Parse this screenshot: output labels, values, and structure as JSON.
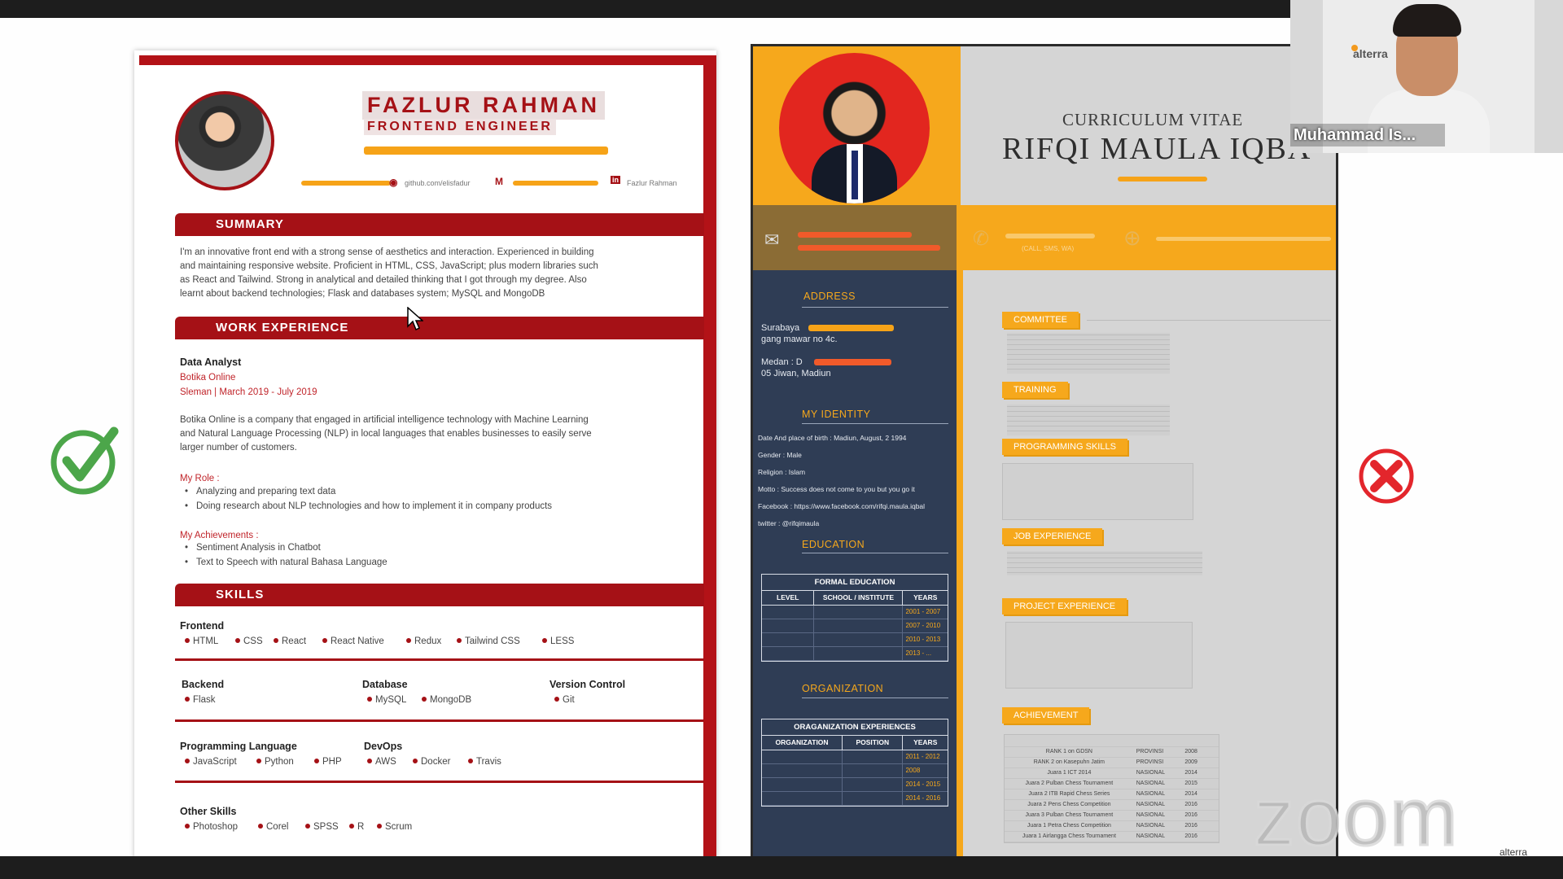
{
  "left_cv": {
    "name": "FAZLUR RAHMAN",
    "role": "FRONTEND ENGINEER",
    "contacts": {
      "github": "github.com/elisfadur",
      "linkedin": "Fazlur Rahman"
    },
    "sections": {
      "summary": "SUMMARY",
      "work": "WORK EXPERIENCE",
      "skills": "SKILLS"
    },
    "summary_lines": [
      "I'm an innovative front end with a strong sense of aesthetics and interaction. Experienced in building",
      "and maintaining responsive website. Proficient in HTML, CSS, JavaScript; plus modern libraries such",
      "as React and Tailwind. Strong in analytical and detailed thinking that I got through my degree. Also",
      "learnt about backend technologies; Flask and databases system; MySQL and MongoDB"
    ],
    "job": {
      "title": "Data Analyst",
      "company": "Botika Online",
      "period": "Sleman | March 2019 - July 2019",
      "desc": [
        "Botika Online is a company that engaged in artificial intelligence technology with Machine Learning",
        "and Natural Language Processing (NLP) in local languages that enables businesses to easily serve",
        "larger number of customers."
      ],
      "role_label": "My Role :",
      "roles": [
        "Analyzing and preparing text data",
        "Doing research about NLP technologies and how to implement it in company products"
      ],
      "ach_label": "My Achievements :",
      "achievements": [
        "Sentiment Analysis in Chatbot",
        "Text to Speech with natural Bahasa Language"
      ]
    },
    "skills": {
      "frontend": {
        "label": "Frontend",
        "items": [
          "HTML",
          "CSS",
          "React",
          "React Native",
          "Redux",
          "Tailwind CSS",
          "LESS"
        ]
      },
      "backend": {
        "label": "Backend",
        "items": [
          "Flask"
        ]
      },
      "database": {
        "label": "Database",
        "items": [
          "MySQL",
          "MongoDB"
        ]
      },
      "vcs": {
        "label": "Version Control",
        "items": [
          "Git"
        ]
      },
      "prog": {
        "label": "Programming Language",
        "items": [
          "JavaScript",
          "Python",
          "PHP"
        ]
      },
      "devops": {
        "label": "DevOps",
        "items": [
          "AWS",
          "Docker",
          "Travis"
        ]
      },
      "other": {
        "label": "Other Skills",
        "items": [
          "Photoshop",
          "Corel",
          "SPSS",
          "R",
          "Scrum"
        ]
      }
    }
  },
  "right_cv": {
    "title": "CURRICULUM VITAE",
    "name": "RIFQI MAULA IQBA",
    "headings": {
      "address": "ADDRESS",
      "identity": "MY IDENTITY",
      "education": "EDUCATION",
      "organization": "ORGANIZATION",
      "committee": "COMMITTEE",
      "training": "TRAINING",
      "programming": "PROGRAMMING SKILLS",
      "job": "JOB EXPERIENCE",
      "project": "PROJECT EXPERIENCE",
      "achievement": "ACHIEVEMENT"
    },
    "address_1a": "Surabaya",
    "address_1b": "gang mawar no 4c.",
    "address_2a": "Medan : D",
    "address_2b": "05 Jiwan, Madiun",
    "identity": [
      "Date And place of birth : Madiun, August, 2   1994",
      "Gender : Male",
      "Religion : Islam",
      "Motto : Success does not come to you but you go it",
      "Facebook : https://www.facebook.com/rifqi.maula.iqbal",
      "twitter : @rifqimaula"
    ],
    "edu_table_title": "FORMAL EDUCATION",
    "edu_cols": [
      "LEVEL",
      "SCHOOL / INSTITUTE",
      "YEARS"
    ],
    "edu_years": [
      "2001 - 2007",
      "2007 - 2010",
      "2010 - 2013",
      "2013 - ..."
    ],
    "org_table_title": "ORAGANIZATION EXPERIENCES",
    "org_cols": [
      "ORGANIZATION",
      "POSITION",
      "YEARS"
    ],
    "org_years": [
      "2011 - 2012",
      "2008",
      "2014 - 2015",
      "2014 - 2016"
    ],
    "phone_hint": "(CALL, SMS, WA)",
    "achievements": [
      [
        "RANK 1 on GDSN",
        "PROVINSI",
        "2008"
      ],
      [
        "RANK 2 on Kasepuhn Jatim",
        "PROVINSI",
        "2009"
      ],
      [
        "Juara 1 ICT 2014",
        "NASIONAL",
        "2014"
      ],
      [
        "Juara 2 Pulban Chess Tournament",
        "NASIONAL",
        "2015"
      ],
      [
        "Juara 2 ITB Rapid Chess Series",
        "NASIONAL",
        "2014"
      ],
      [
        "Juara 2 Pens Chess Competition",
        "NASIONAL",
        "2016"
      ],
      [
        "Juara 3 Pulban Chess Tournament",
        "NASIONAL",
        "2016"
      ],
      [
        "Juara 1 Petra Chess Competition",
        "NASIONAL",
        "2016"
      ],
      [
        "Juara 1 Airlangga Chess Tournament",
        "NASIONAL",
        "2016"
      ]
    ]
  },
  "video": {
    "participant_name": "Muhammad Is...",
    "logo": "alterra"
  },
  "watermark": {
    "zoom": "zoom",
    "brand": "alterra"
  },
  "colors": {
    "left_accent": "#a51116",
    "right_accent": "#f6a81c",
    "right_dark": "#2f3d55"
  }
}
